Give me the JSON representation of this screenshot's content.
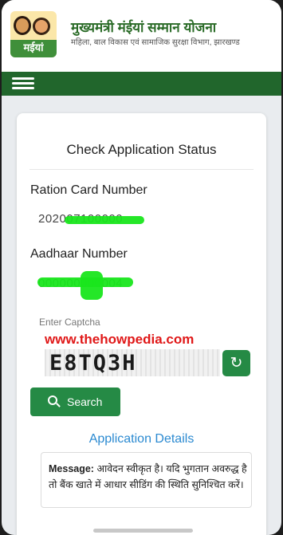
{
  "header": {
    "logo_text": "मईयां",
    "title": "मुख्यमंत्री मंईयां सम्मान योजना",
    "subtitle": "महिला, बाल विकास एवं सामाजिक सुरक्षा विभाग, झारखण्ड"
  },
  "nav": {
    "menu_icon": "hamburger-icon"
  },
  "card": {
    "title": "Check Application Status",
    "ration_label": "Ration Card Number",
    "ration_value": "202007100000",
    "aadhaar_label": "Aadhaar Number",
    "aadhaar_value": "000000000004",
    "captcha_label": "Enter Captcha",
    "watermark": "www.thehowpedia.com",
    "captcha_text": "E8TQ3H",
    "refresh_icon": "refresh-icon",
    "search_label": "Search",
    "search_icon": "search-icon",
    "details_heading": "Application Details",
    "message_label": "Message:",
    "message_text": " आवेदन स्वीकृत है। यदि भुगतान अवरुद्ध है तो बैंक खाते में आधार सीडिंग की स्थिति सुनिश्चित करें।"
  },
  "colors": {
    "brand_green": "#21662c",
    "button_green": "#258a45",
    "title_green": "#2a6b27",
    "link_blue": "#2b8ad1",
    "watermark_red": "#e01818"
  }
}
